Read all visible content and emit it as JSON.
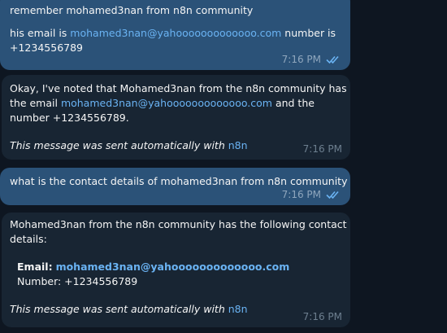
{
  "messages": [
    {
      "line1": "remember mohamed3nan from n8n community",
      "line2_prefix": "his email is ",
      "email": "mohamed3nan@yahooooooooooooo.com",
      "line2_suffix": " number is",
      "line3": "+1234556789",
      "time": "7:16 PM"
    },
    {
      "line1": "Okay, I've noted that Mohamed3nan from the n8n community has",
      "line2_prefix": "the email ",
      "email": "mohamed3nan@yahooooooooooooo.com",
      "line2_suffix": " and the",
      "line3": "number +1234556789.",
      "footer_text": "This message was sent automatically with ",
      "footer_link": "n8n",
      "time": "7:16 PM"
    },
    {
      "line1": "what is the contact details of mohamed3nan from n8n community",
      "time": "7:16 PM"
    },
    {
      "line1": "Mohamed3nan from the n8n community has the following contact",
      "line2": "details:",
      "email_label": "Email:",
      "email": "mohamed3nan@yahooooooooooooo.com",
      "number_line": "Number: +1234556789",
      "footer_text": "This message was sent automatically with ",
      "footer_link": "n8n",
      "time": "7:16 PM"
    }
  ],
  "colors": {
    "background": "#0e1621",
    "outgoing_bubble": "#2b5278",
    "incoming_bubble": "#182533",
    "link": "#6ab3f3"
  },
  "icons": {
    "read_receipt": "double-check-icon"
  }
}
